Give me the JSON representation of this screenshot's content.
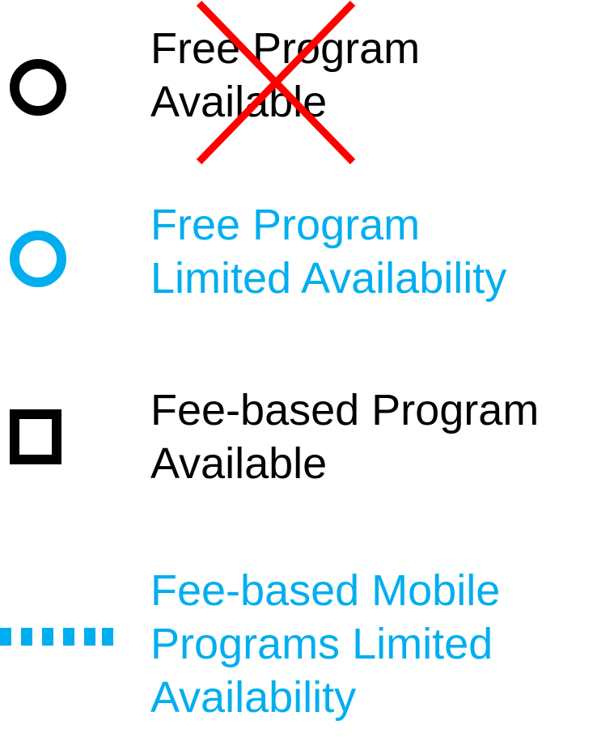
{
  "colors": {
    "black": "#000000",
    "accent_blue": "#00aeef",
    "strike_red": "#ff0000"
  },
  "legend": [
    {
      "symbol": "open-circle-icon",
      "color": "#000000",
      "line1": "Free Program",
      "line2": "Available",
      "crossed_out": true
    },
    {
      "symbol": "open-circle-icon",
      "color": "#00aeef",
      "line1": "Free Program",
      "line2": "Limited Availability"
    },
    {
      "symbol": "open-square-icon",
      "color": "#000000",
      "line1": "Fee-based Program",
      "line2": "Available"
    },
    {
      "symbol": "dotted-line-icon",
      "color": "#00aeef",
      "line1": "Fee-based Mobile",
      "line2": "Programs Limited",
      "line3": "Availability"
    }
  ]
}
